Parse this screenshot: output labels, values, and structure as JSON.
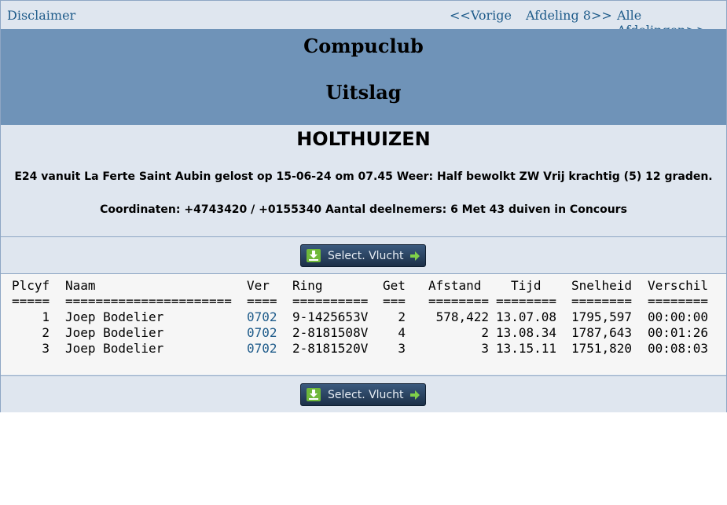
{
  "nav": {
    "disclaimer": "Disclaimer",
    "vorige": "<<Vorige",
    "afdeling": "Afdeling 8>>",
    "alle": "Alle Afdelingen>>"
  },
  "banner": {
    "club": "Compuclub",
    "uitslag": "Uitslag"
  },
  "race": {
    "place": "HOLTHUIZEN",
    "line1": "E24 vanuit La Ferte Saint Aubin gelost op 15-06-24 om 07.45 Weer: Half bewolkt ZW Vrij krachtig (5) 12 graden.",
    "line2": "Coordinaten: +4743420 / +0155340 Aantal deelnemers: 6 Met 43 duiven in Concours"
  },
  "buttons": {
    "select_label": "Select. Vlucht",
    "download_icon": "download-icon",
    "arrow_icon": "arrow-right-icon"
  },
  "table": {
    "headers": {
      "plcyf": "Plcyf",
      "naam": "Naam",
      "ver": "Ver",
      "ring": "Ring",
      "get": "Get",
      "afstand": "Afstand",
      "tijd": "Tijd",
      "snelheid": "Snelheid",
      "verschil": "Verschil"
    },
    "separators": {
      "plcyf": "=====",
      "naam": "======================",
      "ver": "====",
      "ring": "==========",
      "get": "===",
      "afstand": "========",
      "tijd": "========",
      "snelheid": "========",
      "verschil": "========"
    },
    "rows": [
      {
        "plcyf": "1",
        "naam": "Joep Bodelier",
        "ver": "0702",
        "ring": "9-1425653V",
        "get": "2",
        "afstand": "578,422",
        "tijd": "13.07.08",
        "snelheid": "1795,597",
        "verschil": "00:00:00"
      },
      {
        "plcyf": "2",
        "naam": "Joep Bodelier",
        "ver": "0702",
        "ring": "2-8181508V",
        "get": "4",
        "afstand": "2",
        "tijd": "13.08.34",
        "snelheid": "1787,643",
        "verschil": "00:01:26"
      },
      {
        "plcyf": "3",
        "naam": "Joep Bodelier",
        "ver": "0702",
        "ring": "2-8181520V",
        "get": "3",
        "afstand": "3",
        "tijd": "13.15.11",
        "snelheid": "1751,820",
        "verschil": "00:08:03"
      }
    ]
  },
  "colors": {
    "banner": "#6f93b8",
    "panel": "#dfe6ef",
    "link": "#1e5b8a"
  }
}
